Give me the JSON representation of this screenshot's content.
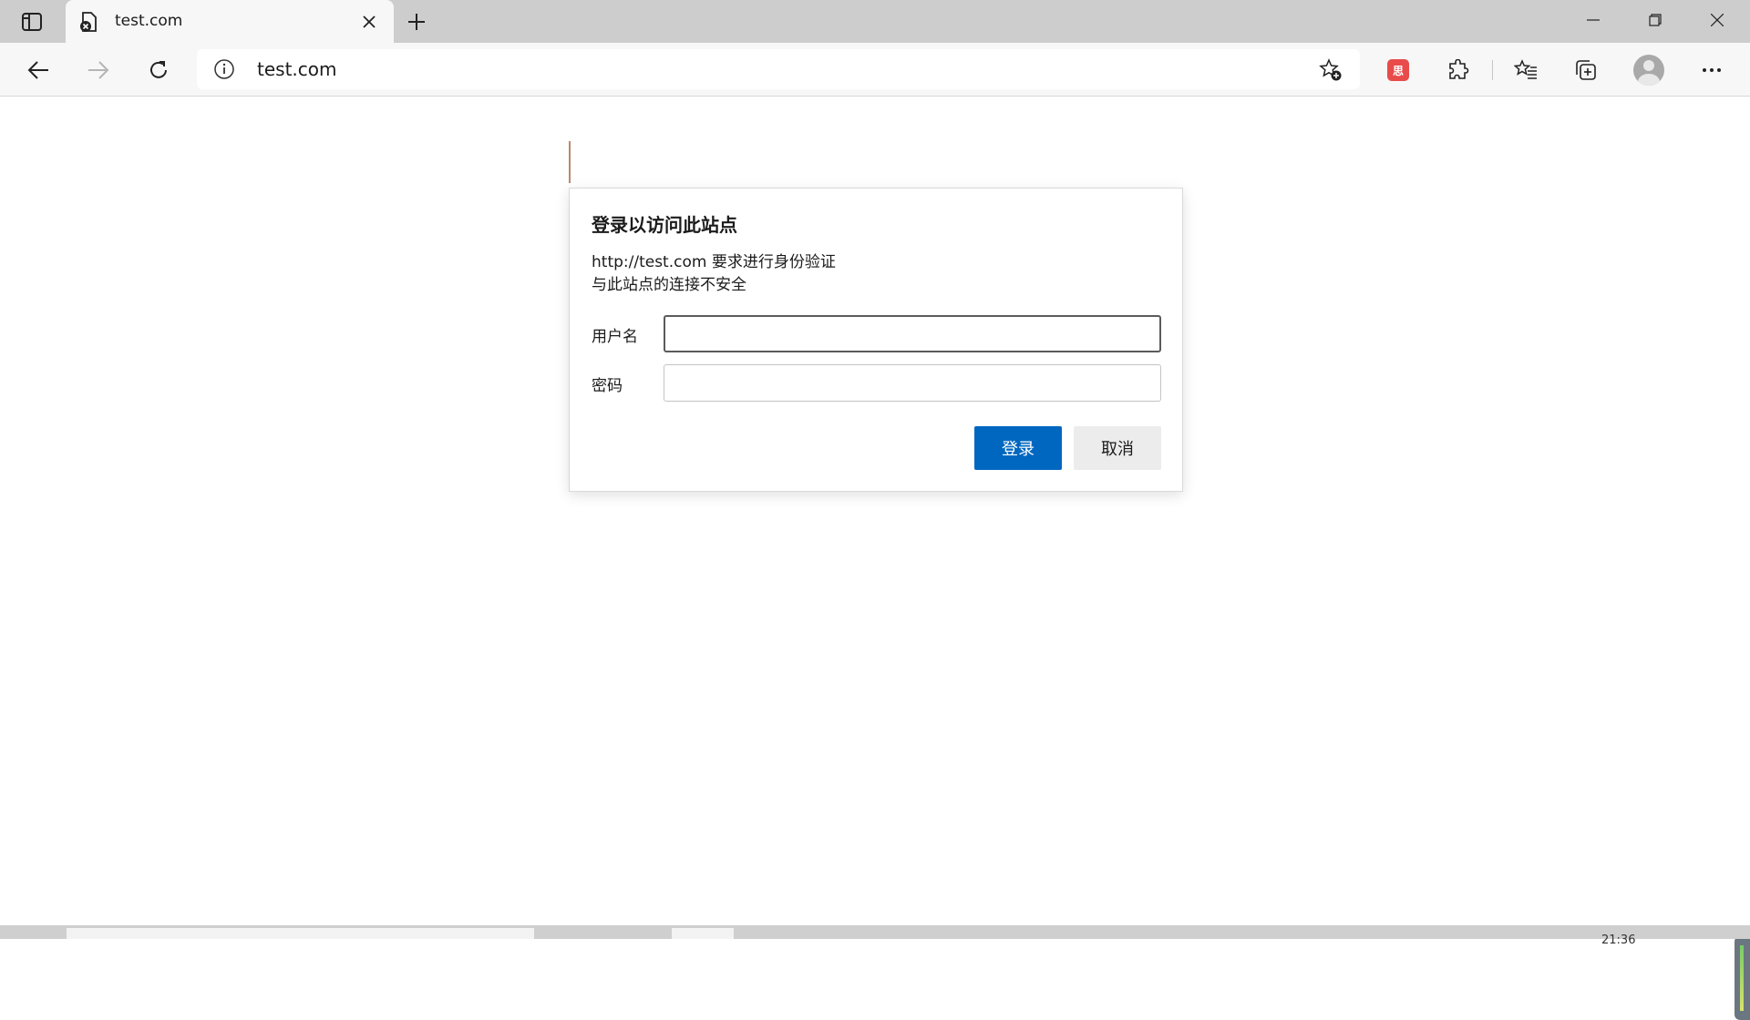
{
  "browser": {
    "tab": {
      "title": "test.com",
      "favicon": "page-error-icon"
    },
    "address_bar": {
      "url": "test.com"
    },
    "extension_badge": "思"
  },
  "dialog": {
    "title": "登录以访问此站点",
    "line1": "http://test.com 要求进行身份验证",
    "line2": "与此站点的连接不安全",
    "username_label": "用户名",
    "username_value": "",
    "password_label": "密码",
    "password_value": "",
    "login_button": "登录",
    "cancel_button": "取消"
  },
  "bottom": {
    "clock": "21:36"
  },
  "colors": {
    "accent": "#0067c0",
    "tabstrip": "#cdcdcd",
    "toolbar": "#f7f7f7"
  }
}
